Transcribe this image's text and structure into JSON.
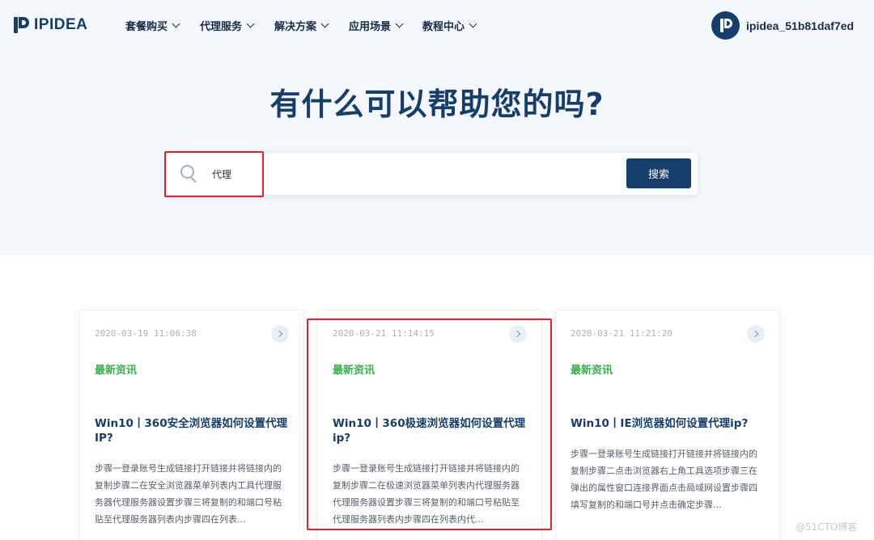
{
  "brand": {
    "name": "IPIDEA"
  },
  "nav": [
    {
      "label": "套餐购买"
    },
    {
      "label": "代理服务"
    },
    {
      "label": "解决方案"
    },
    {
      "label": "应用场景"
    },
    {
      "label": "教程中心"
    }
  ],
  "user": {
    "name": "ipidea_51b81daf7ed"
  },
  "hero": {
    "title": "有什么可以帮助您的吗?"
  },
  "search": {
    "value": "代理",
    "button_label": "搜索"
  },
  "cards": [
    {
      "date": "2020-03-19 11:06:38",
      "tag": "最新资讯",
      "title": "Win10丨360安全浏览器如何设置代理IP?",
      "desc": "步骤一登录账号生成链接打开链接并将链接内的复制步骤二在安全浏览器菜单列表内工具代理服务器代理服务器设置步骤三将复制的和端口号粘贴至代理服务器列表内步骤四在列表..."
    },
    {
      "date": "2020-03-21 11:14:15",
      "tag": "最新资讯",
      "title": "Win10丨360极速浏览器如何设置代理ip?",
      "desc": "步骤一登录账号生成链接打开链接并将链接内的复制步骤二在极速浏览器菜单列表内代理服务器代理服务器设置步骤三将复制的和端口号粘贴至代理服务器列表内步骤四在列表内代..."
    },
    {
      "date": "2020-03-21 11:21:20",
      "tag": "最新资讯",
      "title": "Win10丨IE浏览器如何设置代理ip?",
      "desc": "步骤一登录账号生成链接打开链接并将链接内的复制步骤二点击浏览器右上角工具选项步骤三在弹出的属性窗口连接界面点击局域网设置步骤四填写复制的和端口号并点击确定步骤..."
    }
  ],
  "watermark": "@51CTO博客",
  "colors": {
    "primary": "#163e6c",
    "accent_green": "#34b34a",
    "highlight_red": "#e8202a",
    "hero_bg": "#f4f8fc"
  }
}
